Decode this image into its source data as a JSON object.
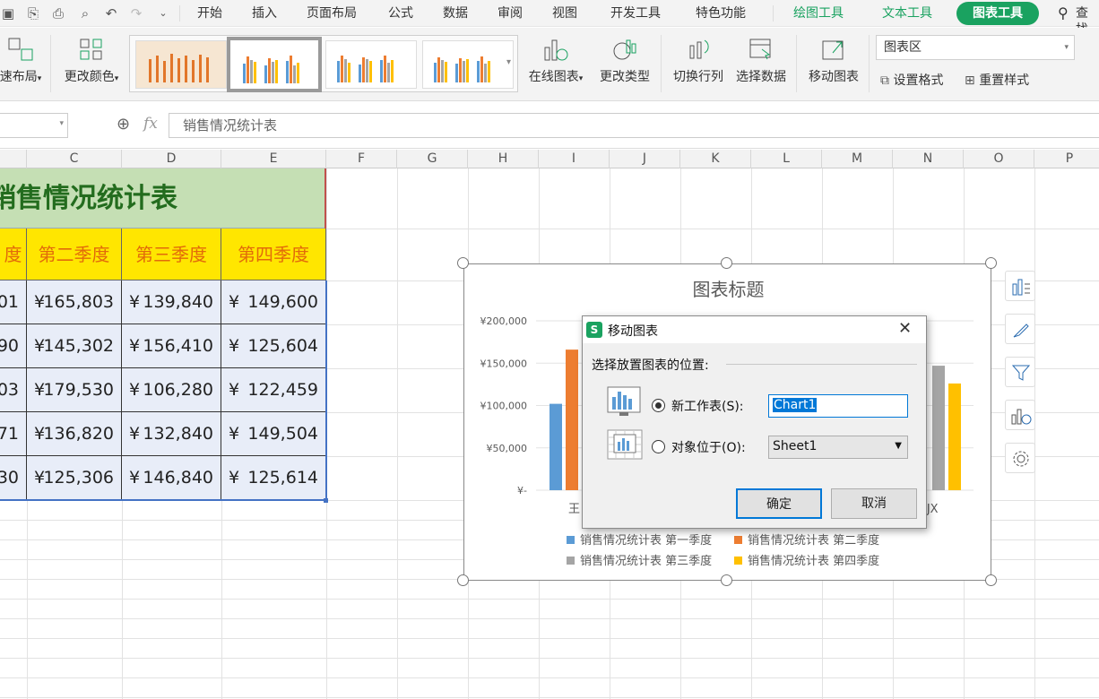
{
  "menu": {
    "tabs": [
      "开始",
      "插入",
      "页面布局",
      "公式",
      "数据",
      "审阅",
      "视图",
      "开发工具",
      "特色功能"
    ],
    "context_tabs": [
      "绘图工具",
      "文本工具"
    ],
    "active_tab": "图表工具",
    "search": "查找"
  },
  "ribbon": {
    "quick_layout": "速布局",
    "change_color": "更改颜色",
    "online_chart": "在线图表",
    "change_type": "更改类型",
    "switch_rowcol": "切换行列",
    "select_data": "选择数据",
    "move_chart": "移动图表",
    "chart_area": "图表区",
    "set_format": "设置格式",
    "reset_style": "重置样式"
  },
  "formula_bar": {
    "fx": "fx",
    "content": "销售情况统计表"
  },
  "columns": [
    "C",
    "D",
    "E",
    "F",
    "G",
    "H",
    "I",
    "J",
    "K",
    "L",
    "M",
    "N",
    "O",
    "P"
  ],
  "sheet": {
    "title": "销售情况统计表",
    "headers": [
      "度",
      "第二季度",
      "第三季度",
      "第四季度"
    ],
    "currency": "¥",
    "rows": [
      [
        "01",
        "165,803",
        "139,840",
        "149,600"
      ],
      [
        "90",
        "145,302",
        "156,410",
        "125,604"
      ],
      [
        "03",
        "179,530",
        "106,280",
        "122,459"
      ],
      [
        "71",
        "136,820",
        "132,840",
        "149,504"
      ],
      [
        "30",
        "125,306",
        "146,840",
        "125,614"
      ]
    ]
  },
  "chart_data": {
    "type": "bar",
    "title": "图表标题",
    "yticks": [
      "¥200,000",
      "¥150,000",
      "¥100,000",
      "¥50,000",
      "¥-"
    ],
    "ylim": [
      0,
      200000
    ],
    "visible_category_labels": [
      "王",
      "IJX"
    ],
    "series": [
      {
        "name": "销售情况统计表 第一季度",
        "color": "#5b9bd5",
        "values": [
          102000
        ]
      },
      {
        "name": "销售情况统计表 第二季度",
        "color": "#ed7d31",
        "values": [
          166000
        ]
      },
      {
        "name": "销售情况统计表 第三季度",
        "color": "#a5a5a5",
        "values": [
          147000
        ]
      },
      {
        "name": "销售情况统计表 第四季度",
        "color": "#ffc000",
        "values": [
          126000
        ]
      }
    ],
    "legend_position": "bottom"
  },
  "dialog": {
    "title": "移动图表",
    "prompt": "选择放置图表的位置:",
    "new_sheet_label": "新工作表(S):",
    "new_sheet_value": "Chart1",
    "object_in_label": "对象位于(O):",
    "object_in_value": "Sheet1",
    "ok": "确定",
    "cancel": "取消"
  }
}
